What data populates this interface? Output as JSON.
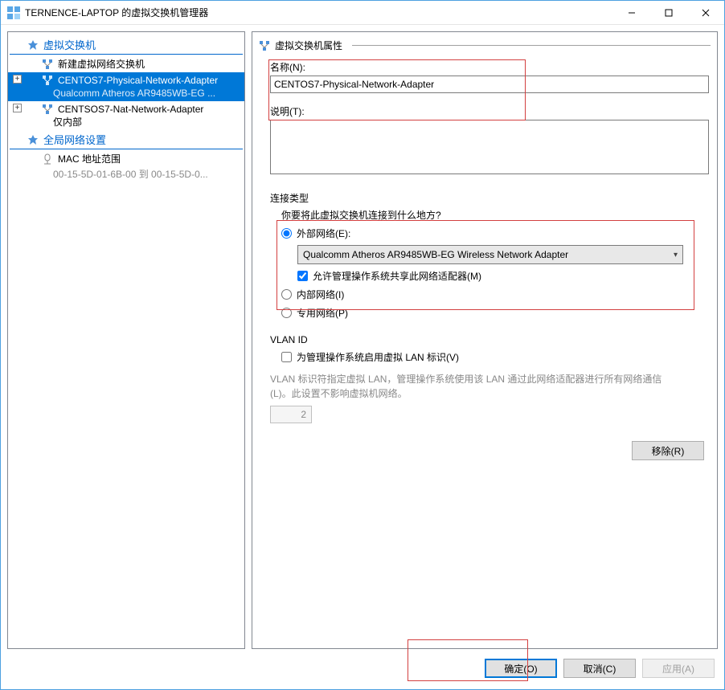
{
  "window": {
    "title": "TERNENCE-LAPTOP 的虚拟交换机管理器"
  },
  "tree": {
    "vswitchHeader": "虚拟交换机",
    "newSwitch": "新建虚拟网络交换机",
    "item1": {
      "name": "CENTOS7-Physical-Network-Adapter",
      "sub": "Qualcomm Atheros AR9485WB-EG ..."
    },
    "item2": {
      "name": "CENTSOS7-Nat-Network-Adapter",
      "sub": "仅内部"
    },
    "globalHeader": "全局网络设置",
    "macLabel": "MAC 地址范围",
    "macRange": "00-15-5D-01-6B-00 到 00-15-5D-0..."
  },
  "props": {
    "header": "虚拟交换机属性",
    "nameLabel": "名称(N):",
    "nameValue": "CENTOS7-Physical-Network-Adapter",
    "descLabel": "说明(T):",
    "descValue": "",
    "connTypeLabel": "连接类型",
    "connQuestion": "你要将此虚拟交换机连接到什么地方?",
    "extLabel": "外部网络(E):",
    "adapter": "Qualcomm Atheros AR9485WB-EG Wireless Network Adapter",
    "shareLabel": "允许管理操作系统共享此网络适配器(M)",
    "intLabel": "内部网络(I)",
    "privLabel": "专用网络(P)",
    "vlanHeader": "VLAN ID",
    "vlanEnable": "为管理操作系统启用虚拟 LAN 标识(V)",
    "vlanDesc": "VLAN 标识符指定虚拟 LAN，管理操作系统使用该 LAN 通过此网络适配器进行所有网络通信(L)。此设置不影响虚拟机网络。",
    "vlanNum": "2",
    "removeBtn": "移除(R)"
  },
  "buttons": {
    "ok": "确定(O)",
    "cancel": "取消(C)",
    "apply": "应用(A)"
  }
}
